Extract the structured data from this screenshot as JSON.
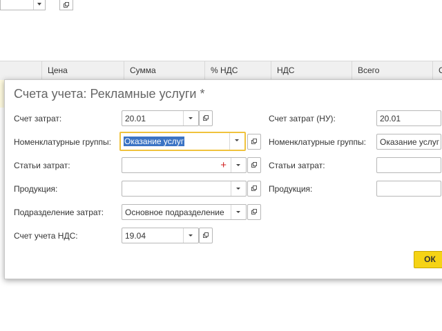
{
  "background": {
    "table_columns": [
      "Цена",
      "Сумма",
      "% НДС",
      "НДС",
      "Всего",
      "С"
    ]
  },
  "dialog": {
    "title": "Счета учета: Рекламные услуги *",
    "left": {
      "cost_account": {
        "label": "Счет затрат:",
        "value": "20.01"
      },
      "nomenclature_groups": {
        "label": "Номенклатурные группы:",
        "value": "Оказание услуг"
      },
      "cost_items": {
        "label": "Статьи затрат:",
        "value": ""
      },
      "products": {
        "label": "Продукция:",
        "value": ""
      },
      "cost_division": {
        "label": "Подразделение затрат:",
        "value": "Основное подразделение"
      },
      "vat_account": {
        "label": "Счет учета НДС:",
        "value": "19.04"
      }
    },
    "right": {
      "cost_account_nu": {
        "label": "Счет затрат (НУ):",
        "value": "20.01"
      },
      "nomenclature_groups": {
        "label": "Номенклатурные группы:",
        "value": "Оказание услуг"
      },
      "cost_items": {
        "label": "Статьи затрат:",
        "value": ""
      },
      "products": {
        "label": "Продукция:",
        "value": ""
      }
    },
    "ok_label": "ОК",
    "required_marker": "+"
  },
  "colors": {
    "accent_focus": "#f0c23c",
    "ok_button": "#f5d315",
    "selection": "#3b73c4",
    "required": "#d02020"
  }
}
